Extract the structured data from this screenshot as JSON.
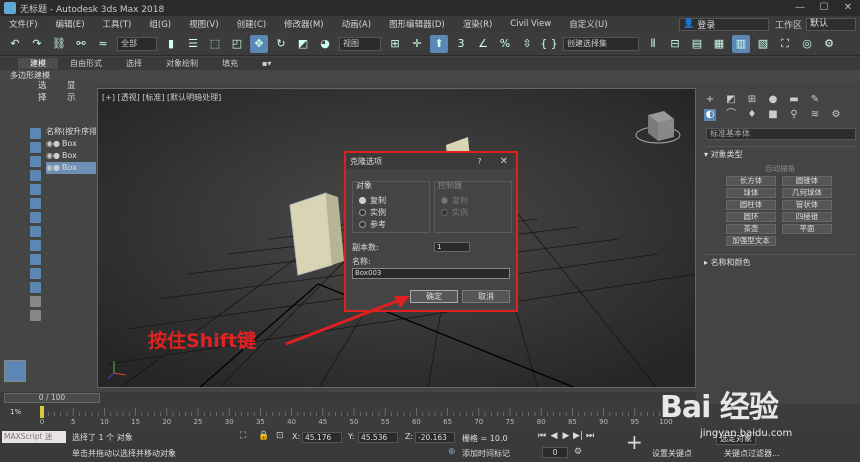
{
  "window": {
    "title": "无标题 - Autodesk 3ds Max 2018"
  },
  "menu": [
    "文件(F)",
    "编辑(E)",
    "工具(T)",
    "组(G)",
    "视图(V)",
    "创建(C)",
    "修改器(M)",
    "动画(A)",
    "图形编辑器(D)",
    "渲染(R)",
    "Civil View",
    "自定义(U)"
  ],
  "login": {
    "label": "登录",
    "workspace_label": "工作区",
    "workspace_value": "默认"
  },
  "toolbar": {
    "filter_value": "全部",
    "refcoord_value": "视图",
    "selset_value": "创建选择集"
  },
  "ribbon": {
    "tabs": [
      "建模",
      "自由形式",
      "选择",
      "对象绘制",
      "填充"
    ],
    "sub": "多边形建模"
  },
  "explorer": {
    "tabs": [
      "选择",
      "显示"
    ],
    "header": "名称(按升序排列)",
    "items": [
      "Box",
      "Box",
      "Box"
    ]
  },
  "viewport": {
    "label": "[+] [透视] [标准] [默认明暗处理]"
  },
  "dialog": {
    "title": "克隆选项",
    "help": "?",
    "object_group": "对象",
    "controller_group": "控制器",
    "object_options": [
      "复制",
      "实例",
      "参考"
    ],
    "controller_options": [
      "复制",
      "实例"
    ],
    "copies_label": "副本数:",
    "copies_value": "1",
    "name_label": "名称:",
    "name_value": "Box003",
    "ok": "确定",
    "cancel": "取消"
  },
  "annotation": "按住Shift键",
  "command_panel": {
    "dropdown": "标准基本体",
    "section1": "对象类型",
    "autogrid": "自动栅格",
    "buttons": [
      "长方体",
      "圆锥体",
      "球体",
      "几何球体",
      "圆柱体",
      "管状体",
      "圆环",
      "四棱锥",
      "茶壶",
      "平面",
      "加强型文本"
    ],
    "section2": "名称和颜色"
  },
  "timeline": {
    "frame_display": "0 / 100",
    "ticks": [
      "0",
      "5",
      "10",
      "15",
      "20",
      "25",
      "30",
      "35",
      "40",
      "45",
      "50",
      "55",
      "60",
      "65",
      "70",
      "75",
      "80",
      "85",
      "90",
      "95",
      "100"
    ],
    "percent": "1%"
  },
  "status": {
    "maxscript": "MAXScript 迷",
    "selected": "选择了 1 个 对象",
    "hint": "单击并拖动以选择并移动对象",
    "x_label": "X:",
    "x_value": "45.176",
    "y_label": "Y:",
    "y_value": "45.536",
    "z_label": "Z:",
    "z_value": "-20.163",
    "grid": "栅格 = 10.0",
    "add_time_tag": "添加时间标记",
    "frame": "0",
    "set_key": "设置关键点",
    "selected_obj": "选定对象",
    "keyfilter": "关键点过滤器..."
  },
  "watermark": {
    "logo": "Bai 经验",
    "url": "jingyan.baidu.com"
  },
  "colors": {
    "highlight": "#5b87b5",
    "annotation": "#e02020"
  }
}
